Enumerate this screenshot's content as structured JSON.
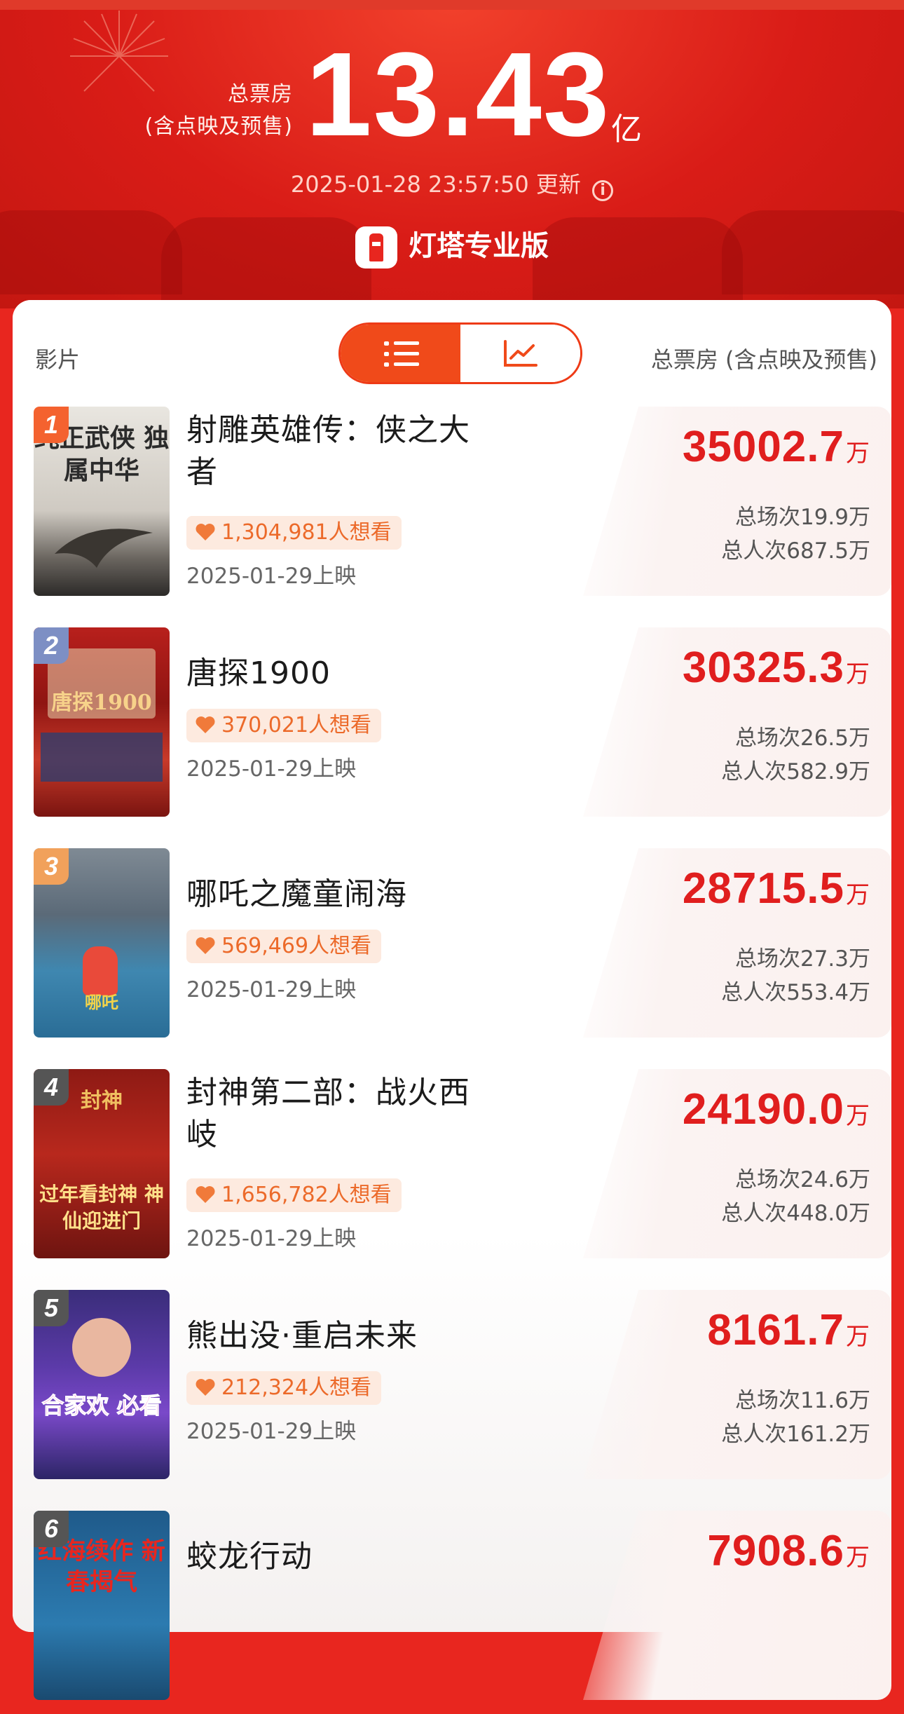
{
  "header": {
    "total_label_line1": "总票房",
    "total_label_line2": "(含点映及预售)",
    "total_value": "13.43",
    "total_unit": "亿",
    "update_time": "2025-01-28 23:57:50",
    "update_suffix": "更新",
    "info_icon": "info-icon",
    "brand_name": "灯塔专业版",
    "brand_icon": "lighthouse-logo-icon"
  },
  "table": {
    "col_film": "影片",
    "col_box_office": "总票房 (含点映及预售)",
    "view_toggle": {
      "list_icon": "list-icon",
      "chart_icon": "trend-chart-icon",
      "active": "list"
    }
  },
  "colors": {
    "accent": "#e8261f",
    "toggle_active": "#f04a1a",
    "box_office_red": "#e01e1e",
    "want_orange": "#ec6a2a",
    "want_bg": "#fdeadf",
    "rank1": "#f4622f",
    "rank2": "#7d8fc4",
    "rank3": "#f1a15b",
    "rank_other": "#555555"
  },
  "movies": [
    {
      "rank": "1",
      "title": "射雕英雄传：侠之大者",
      "want": "1,304,981人想看",
      "release": "2025-01-29上映",
      "box_office": "35002.7",
      "unit": "万",
      "shows": "总场次19.9万",
      "admissions": "总人次687.5万",
      "poster_text": "纯正武侠 独属中华"
    },
    {
      "rank": "2",
      "title": "唐探1900",
      "want": "370,021人想看",
      "release": "2025-01-29上映",
      "box_office": "30325.3",
      "unit": "万",
      "shows": "总场次26.5万",
      "admissions": "总人次582.9万",
      "poster_text": "唐探1900"
    },
    {
      "rank": "3",
      "title": "哪吒之魔童闹海",
      "want": "569,469人想看",
      "release": "2025-01-29上映",
      "box_office": "28715.5",
      "unit": "万",
      "shows": "总场次27.3万",
      "admissions": "总人次553.4万",
      "poster_text": "哪吒"
    },
    {
      "rank": "4",
      "title": "封神第二部：战火西岐",
      "want": "1,656,782人想看",
      "release": "2025-01-29上映",
      "box_office": "24190.0",
      "unit": "万",
      "shows": "总场次24.6万",
      "admissions": "总人次448.0万",
      "poster_text": "过年看封神 神仙迎进门"
    },
    {
      "rank": "5",
      "title": "熊出没·重启未来",
      "want": "212,324人想看",
      "release": "2025-01-29上映",
      "box_office": "8161.7",
      "unit": "万",
      "shows": "总场次11.6万",
      "admissions": "总人次161.2万",
      "poster_text": "合家欢 必看"
    },
    {
      "rank": "6",
      "title": "蛟龙行动",
      "want": "",
      "release": "",
      "box_office": "7908.6",
      "unit": "万",
      "shows": "",
      "admissions": "",
      "poster_text": "红海续作 新春揭气"
    }
  ]
}
